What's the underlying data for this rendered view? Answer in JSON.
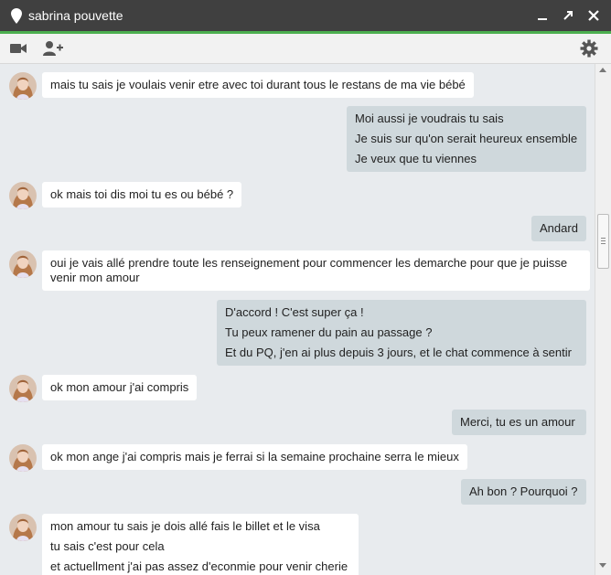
{
  "window": {
    "title": "sabrina pouvette",
    "minimize_glyph": "–",
    "maximize_glyph": "↗",
    "close_glyph": "✕"
  },
  "toolbar": {
    "icons": [
      "video-call-icon",
      "add-person-icon",
      "settings-gear-icon"
    ]
  },
  "colors": {
    "titlebar": "#404040",
    "accent": "#4caf50",
    "chat_bg": "#e8ebee",
    "incoming_bubble": "#ffffff",
    "outgoing_bubble": "#cfd8dc"
  },
  "messages": [
    {
      "from": "contact",
      "lines": [
        "mais tu sais je voulais venir etre avec toi durant tous le restans de ma vie bébé"
      ]
    },
    {
      "from": "me",
      "lines": [
        "Moi aussi je voudrais tu sais",
        "Je suis sur qu'on serait heureux ensemble",
        "Je veux que tu viennes"
      ]
    },
    {
      "from": "contact",
      "lines": [
        "ok mais toi dis moi tu es ou bébé ?"
      ]
    },
    {
      "from": "me",
      "lines": [
        "Andard"
      ]
    },
    {
      "from": "contact",
      "lines": [
        "oui je vais allé prendre toute les renseignement pour commencer les demarche pour que je puisse venir mon amour"
      ]
    },
    {
      "from": "me",
      "lines": [
        "D'accord ! C'est super ça !",
        "Tu peux ramener du pain au passage ?",
        "Et du PQ, j'en ai plus depuis 3 jours, et le chat commence à sentir"
      ]
    },
    {
      "from": "contact",
      "lines": [
        "ok mon amour j'ai compris"
      ]
    },
    {
      "from": "me",
      "lines": [
        "Merci, tu es un amour"
      ]
    },
    {
      "from": "contact",
      "lines": [
        "ok mon ange j'ai compris mais je ferrai si la semaine prochaine serra le mieux"
      ]
    },
    {
      "from": "me",
      "lines": [
        "Ah bon ? Pourquoi ?"
      ]
    },
    {
      "from": "contact",
      "lines": [
        "mon amour tu sais je dois allé fais le billet et le visa",
        "tu sais c'est pour cela",
        "et actuellment j'ai pas assez d'econmie pour venir cherie"
      ]
    }
  ]
}
